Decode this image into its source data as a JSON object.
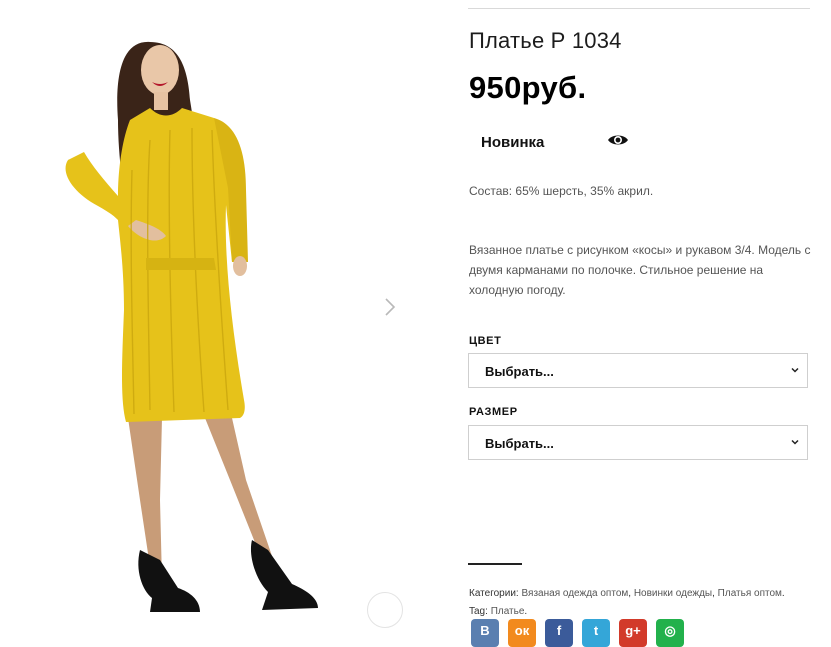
{
  "product": {
    "title": "Платье Р 1034",
    "price": "950руб.",
    "badge": "Новинка",
    "composition": "Состав: 65% шерсть, 35% акрил.",
    "description": "Вязанное платье с рисунком «косы» и рукавом 3/4. Модель с двумя карманами по полочке. Стильное решение на холодную погоду."
  },
  "options": {
    "color": {
      "label": "ЦВЕТ",
      "selected": "Выбрать..."
    },
    "size": {
      "label": "РАЗМЕР",
      "selected": "Выбрать..."
    }
  },
  "meta": {
    "categories_label": "Категории:",
    "categories": [
      "Вязаная одежда оптом",
      "Новинки одежды",
      "Платья оптом"
    ],
    "separator": ",",
    "end": ".",
    "tag_label": "Tag:",
    "tag": "Платье",
    "tag_end": "."
  },
  "share": [
    {
      "name": "vk",
      "glyph": "B",
      "color": "#5a7fb0"
    },
    {
      "name": "odnoklassniki",
      "glyph": "ок",
      "color": "#f28a1e"
    },
    {
      "name": "facebook",
      "glyph": "f",
      "color": "#3b5b9a"
    },
    {
      "name": "twitter",
      "glyph": "t",
      "color": "#34a6d8"
    },
    {
      "name": "google-plus",
      "glyph": "g+",
      "color": "#d23a2a"
    },
    {
      "name": "odnoklassniki-green",
      "glyph": "◎",
      "color": "#22b14c"
    }
  ],
  "icons": {
    "next": "chevron-right-icon",
    "zoom": "zoom-icon",
    "view": "eye-icon",
    "select_arrow": "chevron-down-icon"
  },
  "colors": {
    "dress": "#e6c21a",
    "text": "#222222",
    "muted": "#555555",
    "border": "#cfcfcf"
  }
}
